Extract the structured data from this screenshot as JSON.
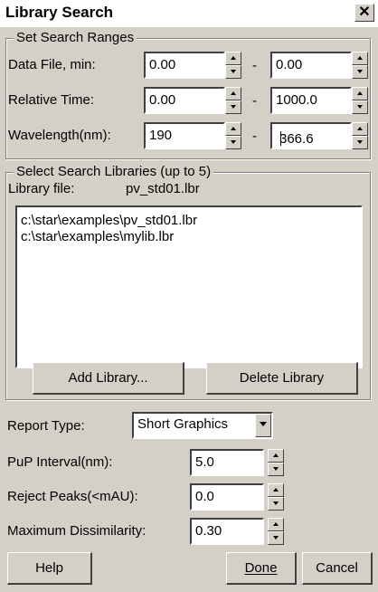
{
  "window": {
    "title": "Library Search",
    "close_glyph": "✕"
  },
  "ranges": {
    "legend": "Set Search Ranges",
    "rows": [
      {
        "label": "Data File, min:",
        "from": "0.00",
        "to": "0.00"
      },
      {
        "label": "Relative Time:",
        "from": "0.00",
        "to": "1000.0"
      },
      {
        "label": "Wavelength(nm):",
        "from": "190",
        "to": "366.6"
      }
    ],
    "separator": "-"
  },
  "libraries": {
    "legend": "Select Search Libraries (up to 5)",
    "file_label": "Library file:",
    "file_value": "pv_std01.lbr",
    "items": [
      "c:\\star\\examples\\pv_std01.lbr",
      "c:\\star\\examples\\mylib.lbr"
    ],
    "add_label": "Add Library...",
    "delete_label": "Delete Library"
  },
  "report": {
    "label": "Report Type:",
    "value": "Short Graphics"
  },
  "params": [
    {
      "label": "PuP Interval(nm):",
      "value": "5.0"
    },
    {
      "label": "Reject Peaks(<mAU):",
      "value": "0.0"
    },
    {
      "label": "Maximum Dissimilarity:",
      "value": "0.30"
    }
  ],
  "footer": {
    "help_label": "Help",
    "done_label": "Done",
    "cancel_label": "Cancel"
  }
}
